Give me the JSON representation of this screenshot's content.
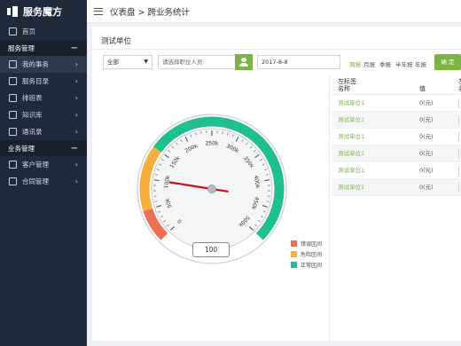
{
  "app": {
    "logo_text": "服务魔方"
  },
  "sidebar": {
    "items": [
      {
        "label": "首页",
        "icon": "home-icon"
      }
    ],
    "sections": [
      {
        "title": "服务管理",
        "toggle": "−",
        "items": [
          {
            "label": "我的事务",
            "icon": "task-icon",
            "active": true
          },
          {
            "label": "服务目录",
            "icon": "catalog-icon"
          },
          {
            "label": "排班表",
            "icon": "schedule-icon"
          },
          {
            "label": "知识库",
            "icon": "knowledge-icon"
          },
          {
            "label": "通讯录",
            "icon": "contacts-icon"
          }
        ]
      },
      {
        "title": "业务管理",
        "toggle": "−",
        "items": [
          {
            "label": "客户管理",
            "icon": "customer-icon"
          },
          {
            "label": "合同管理",
            "icon": "contract-icon"
          }
        ]
      }
    ]
  },
  "header": {
    "breadcrumb": "仪表盘 > 跨业务统计"
  },
  "panel": {
    "title": "测试单位",
    "filters": {
      "scope": "全部",
      "person_placeholder": "请选择职位人员",
      "date": "2017-8-8",
      "periods": [
        "周报",
        "月报",
        "季报",
        "半年报",
        "年报"
      ],
      "active_period": "周报",
      "confirm": "确 定"
    },
    "gauge": {
      "min": 0,
      "max": 500,
      "value": 100,
      "value_text": "100",
      "tick_labels": [
        "0",
        "50k",
        "100k",
        "150k",
        "200k",
        "250k",
        "300k",
        "350k",
        "400k",
        "450k",
        "500k"
      ],
      "bands": [
        {
          "name": "错误区间",
          "from": 0,
          "to": 50,
          "color": "#ef6f52"
        },
        {
          "name": "危险区间",
          "from": 50,
          "to": 150,
          "color": "#f5b041"
        },
        {
          "name": "正常区间",
          "from": 150,
          "to": 500,
          "color": "#1fbf8f"
        }
      ]
    },
    "table": {
      "header_top": "左标签",
      "header_col1": "名称",
      "header_col2": "值",
      "header_clip_top": "左",
      "header_clip_bottom": "名",
      "rows": [
        {
          "name": "测试单位1",
          "value": "0(元)"
        },
        {
          "name": "测试单位1",
          "value": "0(元)"
        },
        {
          "name": "测试单位1",
          "value": "0(元)"
        },
        {
          "name": "测试单位1",
          "value": "0(元)"
        },
        {
          "name": "测试单位1",
          "value": "0(元)"
        },
        {
          "name": "测试单位1",
          "value": "0(元)"
        }
      ]
    }
  }
}
